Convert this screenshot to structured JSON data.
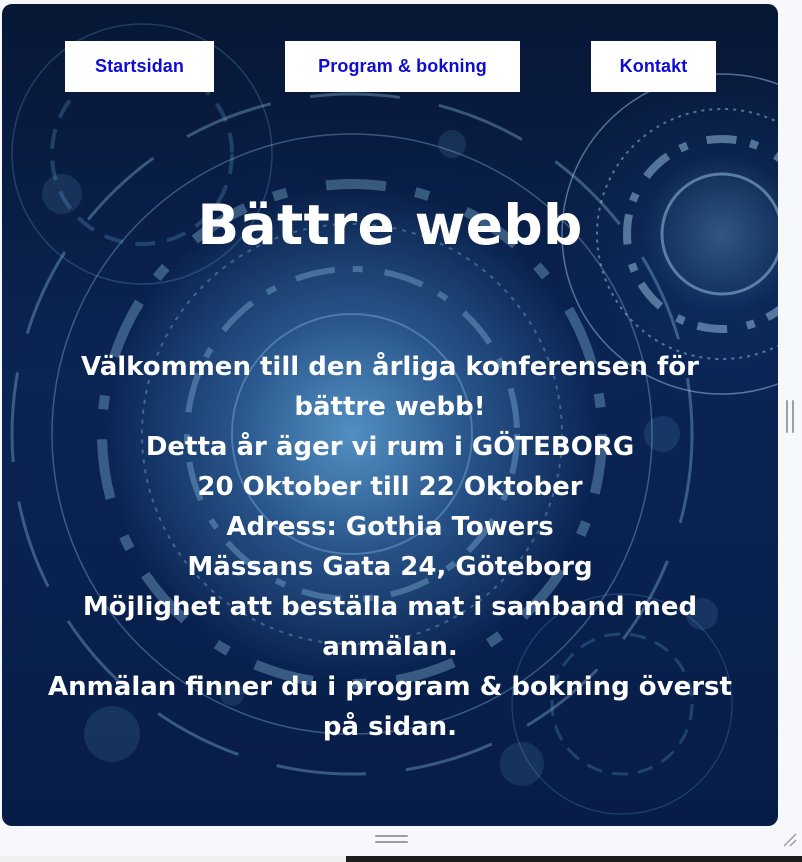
{
  "nav": {
    "items": [
      {
        "label": "Startsidan"
      },
      {
        "label": "Program & bokning"
      },
      {
        "label": "Kontakt"
      }
    ]
  },
  "main": {
    "title": "Bättre webb",
    "lines": [
      "Välkommen till den årliga konferensen för bättre webb!",
      "Detta år äger vi rum i GÖTEBORG",
      "20 Oktober till 22 Oktober",
      "Adress: Gothia Towers",
      "Mässans Gata 24, Göteborg",
      "Möjlighet att beställa mat i samband med anmälan.",
      "Anmälan finner du i program & bokning överst på sidan."
    ]
  },
  "colors": {
    "nav_link": "#0d0bd6",
    "nav_bg": "#ffffff",
    "hero_text": "#ffffff",
    "hero_bg": "#0a2453"
  }
}
